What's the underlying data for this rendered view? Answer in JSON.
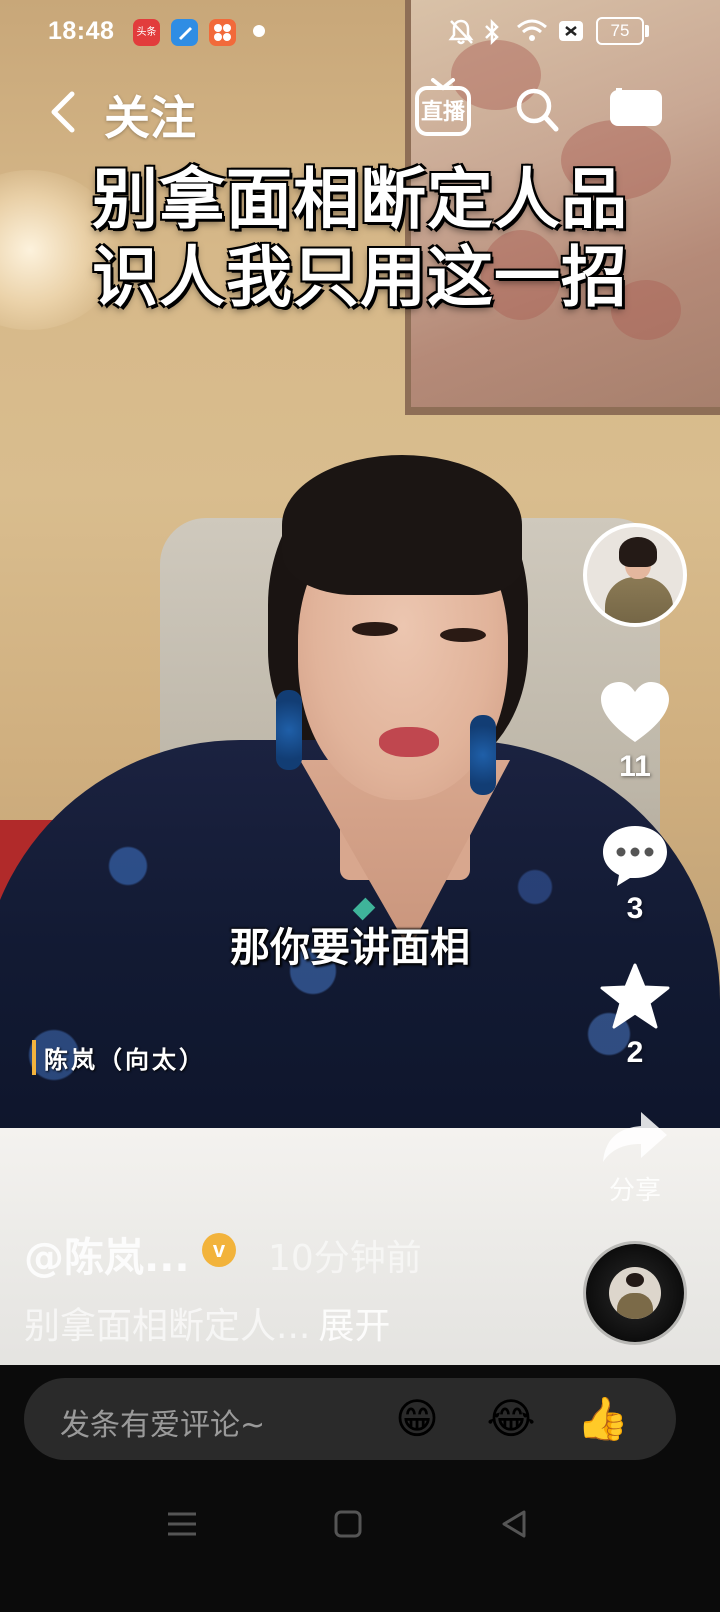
{
  "status_bar": {
    "time": "18:48",
    "battery": "75",
    "app_badges": [
      "toutiao-app-icon",
      "blue-app-icon",
      "orange-app-icon"
    ],
    "badge_toutiao_text": "头条",
    "icons": [
      "mute-bell-icon",
      "bluetooth-icon",
      "wifi-icon",
      "sim-off-icon",
      "battery-icon"
    ]
  },
  "top_nav": {
    "back_title": "关注",
    "live_label": "直播",
    "icons": [
      "back-chevron-icon",
      "live-tv-icon",
      "search-icon",
      "camera-icon"
    ]
  },
  "video": {
    "title_line1": "别拿面相断定人品",
    "title_line2": "识人我只用这一招",
    "subtitle": "那你要讲面相",
    "speaker_tag": "陈岚（向太）"
  },
  "rail": {
    "like_count": "11",
    "comment_count": "3",
    "favorite_count": "2",
    "share_label": "分享"
  },
  "post": {
    "author": "@陈岚...",
    "verified_mark": "v",
    "time_ago": "10分钟前",
    "caption": "别拿面相断定人...",
    "expand_label": "展开"
  },
  "comment_bar": {
    "placeholder": "发条有爱评论~",
    "emojis": [
      "😁",
      "😂",
      "👍"
    ]
  },
  "colors": {
    "verified": "#f2b33b",
    "comment_bar_bg": "#2a2a2a",
    "speaker_accent": "#f3b33d"
  }
}
